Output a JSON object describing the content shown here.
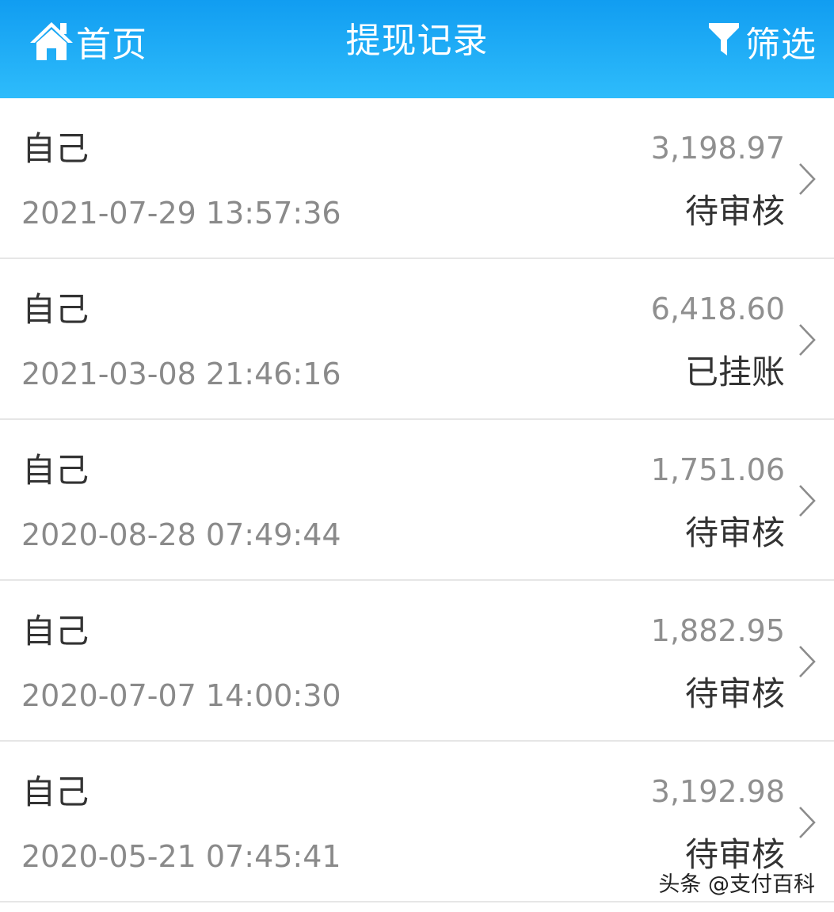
{
  "header": {
    "home_label": "首页",
    "title": "提现记录",
    "filter_label": "筛选",
    "home_icon": "home-icon",
    "filter_icon": "funnel-filter-icon"
  },
  "colors": {
    "header_bg_top": "#119df1",
    "header_bg_bottom": "#2ebcfb",
    "amount_text": "#8f8f8f",
    "date_text": "#8a8a8a"
  },
  "records": [
    {
      "payee": "自己",
      "datetime": "2021-07-29 13:57:36",
      "amount": "3,198.97",
      "status": "待审核"
    },
    {
      "payee": "自己",
      "datetime": "2021-03-08 21:46:16",
      "amount": "6,418.60",
      "status": "已挂账"
    },
    {
      "payee": "自己",
      "datetime": "2020-08-28 07:49:44",
      "amount": "1,751.06",
      "status": "待审核"
    },
    {
      "payee": "自己",
      "datetime": "2020-07-07 14:00:30",
      "amount": "1,882.95",
      "status": "待审核"
    },
    {
      "payee": "自己",
      "datetime": "2020-05-21 07:45:41",
      "amount": "3,192.98",
      "status": "待审核"
    }
  ],
  "watermark": "头条 @支付百科"
}
